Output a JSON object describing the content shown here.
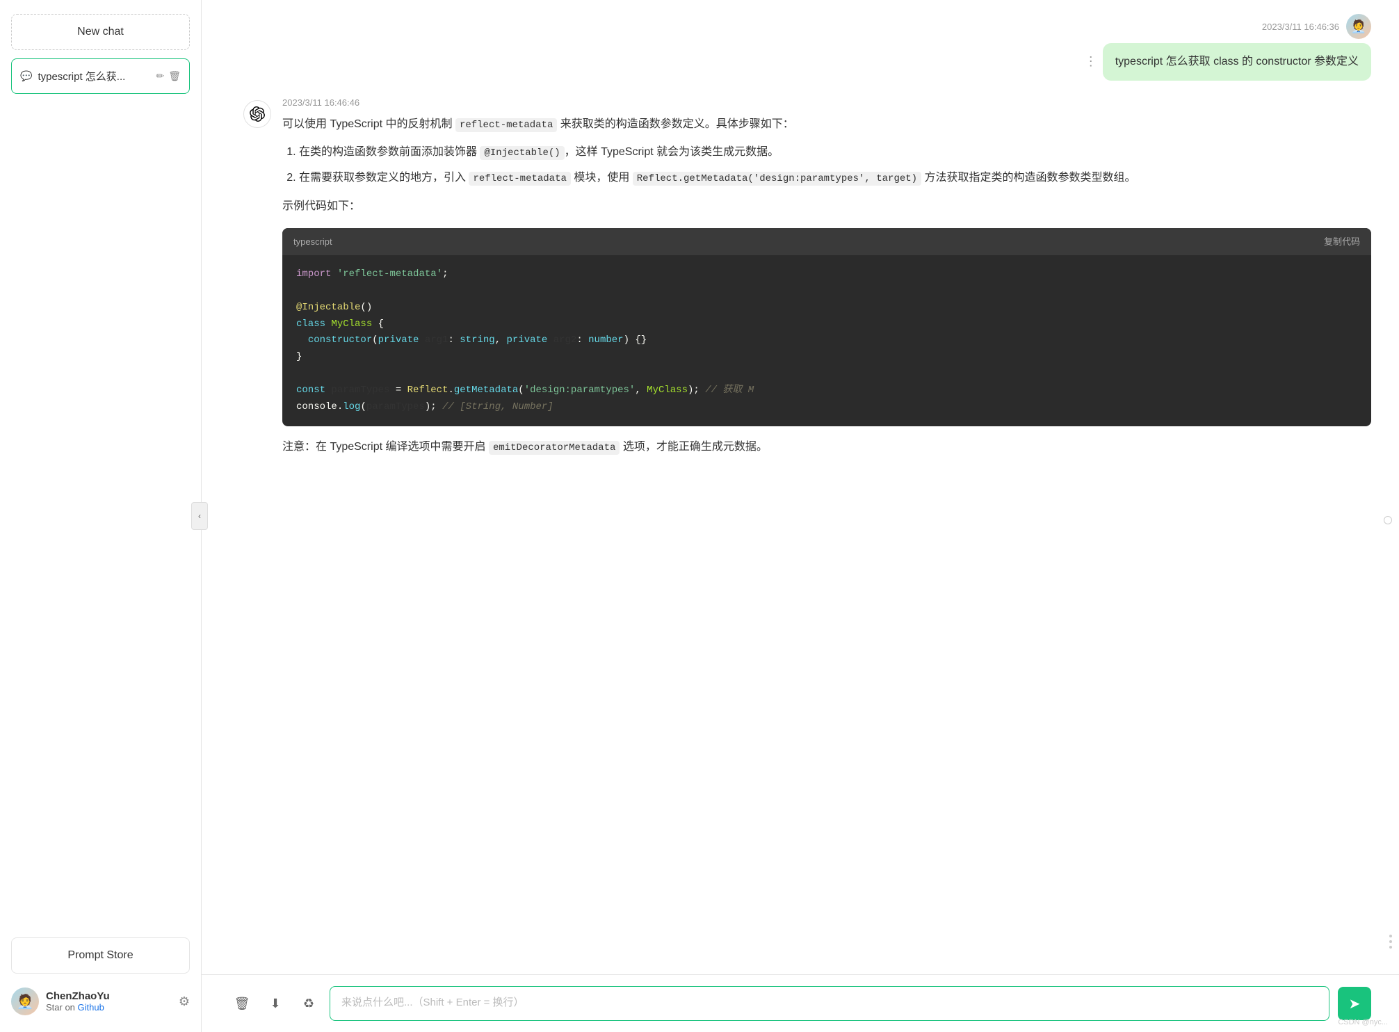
{
  "sidebar": {
    "new_chat_label": "New chat",
    "chat_items": [
      {
        "id": "1",
        "title": "typescript 怎么获...",
        "icon": "💬"
      }
    ],
    "prompt_store_label": "Prompt Store",
    "user": {
      "name": "ChenZhaoYu",
      "sub_text": "Star on Github",
      "avatar_emoji": "🧑‍💼"
    }
  },
  "header": {
    "timestamp_user": "2023/3/11 16:46:36",
    "timestamp_ai": "2023/3/11 16:46:46"
  },
  "messages": {
    "user_message": "typescript 怎么获取 class 的 constructor 参数定义",
    "ai_intro": "可以使用 TypeScript 中的反射机制",
    "ai_intro_code": "reflect-metadata",
    "ai_intro_rest": "来获取类的构造函数参数定义。具体步骤如下：",
    "step1": "在类的构造函数参数前面添加装饰器",
    "step1_code": "@Injectable()",
    "step1_rest": "，这样 TypeScript 就会为该类生成元数据。",
    "step2": "在需要获取参数定义的地方，引入",
    "step2_code": "reflect-metadata",
    "step2_rest": "模块，使用",
    "step2_code2": "Reflect.getMetadata('design:paramtypes', target)",
    "step2_rest2": "方法获取指定类的构造函数参数类型数组。",
    "example_label": "示例代码如下：",
    "code_lang": "typescript",
    "copy_label": "复制代码",
    "code_lines": [
      {
        "type": "import",
        "text": "import 'reflect-metadata';"
      },
      {
        "type": "blank"
      },
      {
        "type": "decorator",
        "text": "@Injectable()"
      },
      {
        "type": "class",
        "text": "class MyClass {"
      },
      {
        "type": "constructor",
        "text": "  constructor(private arg1: string, private arg2: number) {}"
      },
      {
        "type": "close",
        "text": "}"
      },
      {
        "type": "blank"
      },
      {
        "type": "const",
        "text": "const paramTypes = Reflect.getMetadata('design:paramtypes', MyClass); // 获取 M"
      },
      {
        "type": "log",
        "text": "console.log(paramTypes); // [String, Number]"
      }
    ],
    "note_prefix": "注意：在 TypeScript 编译选项中需要开启",
    "note_code": "emitDecoratorMetadata",
    "note_suffix": "选项，才能正确生成元数据。"
  },
  "input": {
    "placeholder": "来说点什么吧...（Shift + Enter = 换行）"
  },
  "icons": {
    "chat_icon": "💬",
    "edit_icon": "✏",
    "delete_icon": "🗑",
    "settings_icon": "⚙",
    "trash_icon": "🗑",
    "download_icon": "⬇",
    "refresh_icon": "♻",
    "send_icon": "➤",
    "collapse_icon": "‹",
    "dots_icon": "⋮"
  },
  "colors": {
    "accent": "#19c37d",
    "user_bubble": "#d4f5d4",
    "code_bg": "#2b2b2b",
    "code_header_bg": "#3a3a3a"
  }
}
